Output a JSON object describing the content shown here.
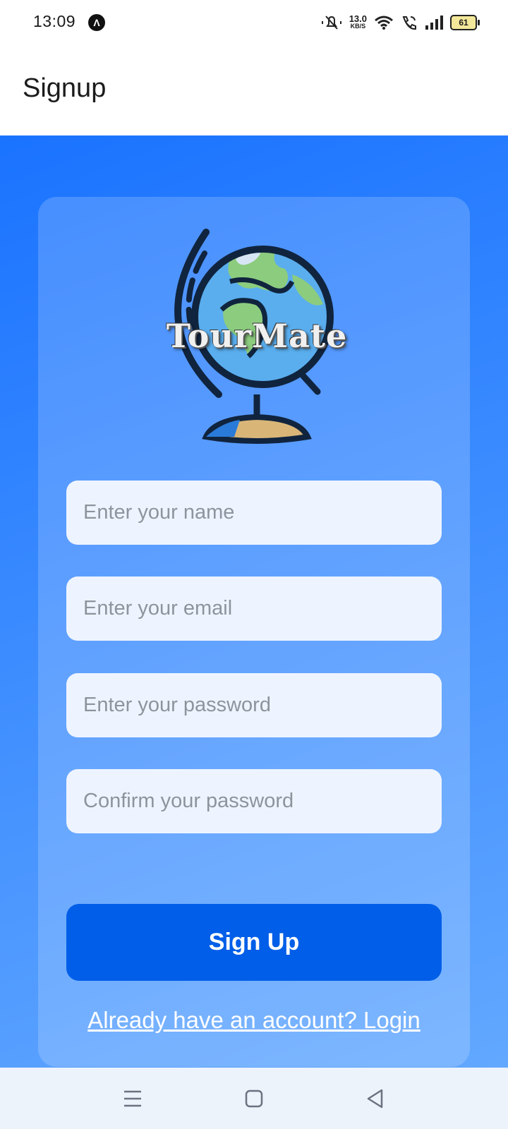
{
  "status_bar": {
    "time": "13:09",
    "notif_glyph": "Λ",
    "speed_value": "13.0",
    "speed_unit": "KB/S",
    "battery": "61"
  },
  "app_bar": {
    "title": "Signup"
  },
  "logo": {
    "text": "TourMate"
  },
  "form": {
    "name_placeholder": "Enter your name",
    "email_placeholder": "Enter your email",
    "password_placeholder": "Enter your password",
    "confirm_placeholder": "Confirm your password",
    "submit_label": "Sign Up",
    "login_link": "Already have an account? Login"
  },
  "icons": {
    "menu": "menu-icon",
    "home": "home-icon",
    "back": "back-icon",
    "globe": "globe-icon"
  },
  "colors": {
    "primary": "#005ee8",
    "background": "#1a73ff",
    "field": "#eef4ff"
  }
}
